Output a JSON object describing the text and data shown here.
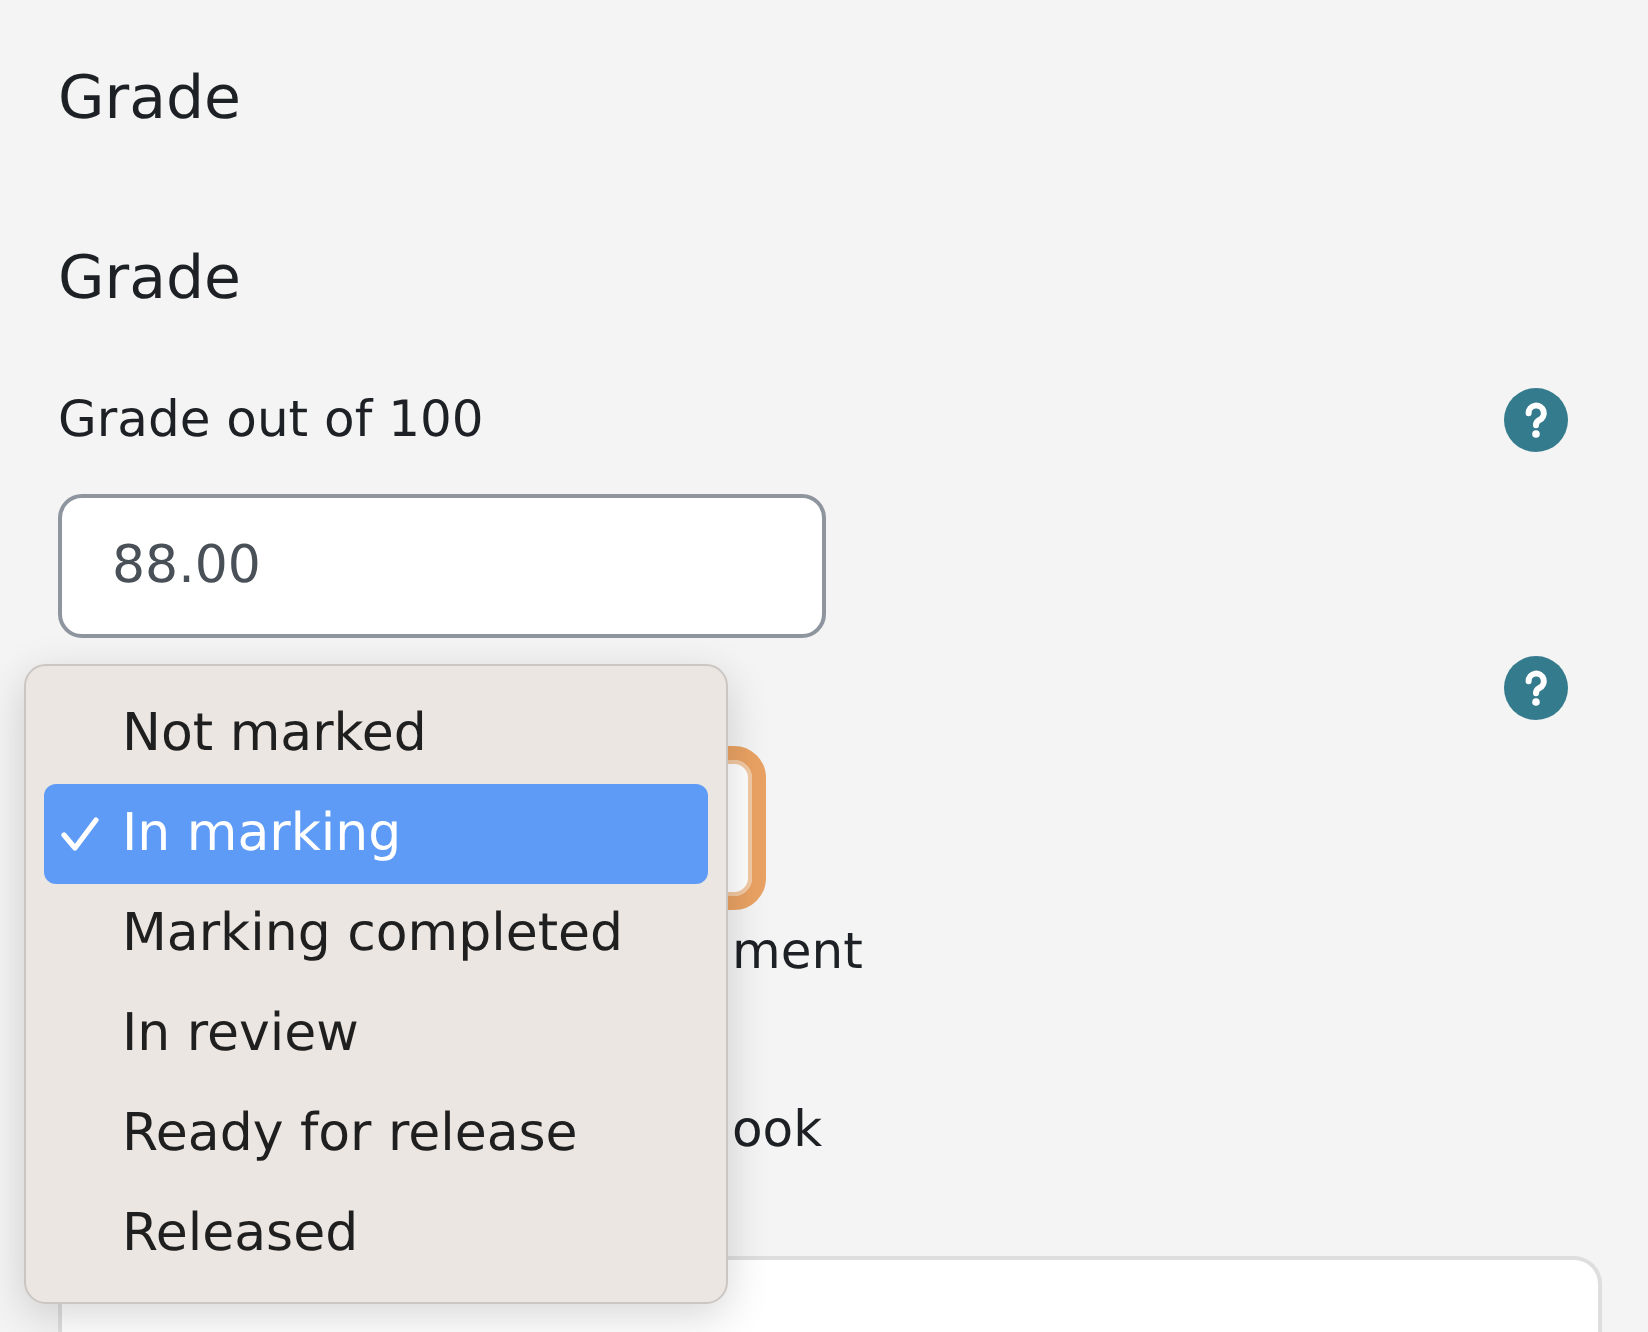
{
  "heading": "Grade",
  "section": {
    "heading": "Grade"
  },
  "fields": [
    {
      "kind": "number",
      "label": "Grade out of 100",
      "help": true,
      "value": "88.00"
    },
    {
      "kind": "select",
      "help": true,
      "focused": true
    },
    {
      "kind": "label",
      "text": "ment"
    },
    {
      "kind": "label",
      "text": "ook"
    },
    {
      "kind": "editor"
    }
  ],
  "dropdown": {
    "options": [
      {
        "label": "Not marked",
        "selected": false
      },
      {
        "label": "In marking",
        "selected": true
      },
      {
        "label": "Marking completed",
        "selected": false
      },
      {
        "label": "In review",
        "selected": false
      },
      {
        "label": "Ready for release",
        "selected": false
      },
      {
        "label": "Released",
        "selected": false
      }
    ]
  }
}
